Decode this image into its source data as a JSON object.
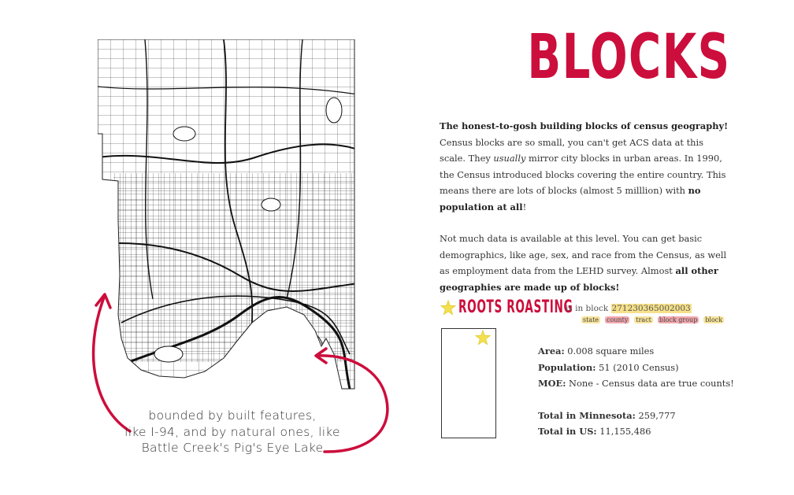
{
  "title": "BLOCKS",
  "intro": {
    "heading": "The honest-to-gosh building blocks of census geography!",
    "text1": " Census blocks are so small, you can't get ACS data at this scale. They ",
    "usually": "usually",
    "text2": " mirror city blocks in urban areas. In 1990, the Census introduced blocks covering the entire country. This means there are lots of blocks (almost 5 milllion) with ",
    "bold_end": "no population at all",
    "end": "!"
  },
  "para2": {
    "text": "Not much data is available at this level. You can get basic demographics, like age, sex, and race from the Census, as well as employment data from the LEHD survey. Almost ",
    "bold": "all other geographies are made up of blocks!"
  },
  "store": {
    "name": "ROOTS ROASTING",
    "phrase": "is in block ",
    "block_id": "271230365002003",
    "labels": {
      "state": "state",
      "county": "county",
      "tract": "tract",
      "block_group": "block group",
      "block": "block"
    }
  },
  "stats": {
    "area_label": "Area:",
    "area_value": " 0.008 square miles",
    "population_label": "Population:",
    "population_value": " 51 (2010 Census)",
    "moe_label": "MOE:",
    "moe_value": " None - Census data are true counts!",
    "total_mn_label": "Total in Minnesota:",
    "total_mn_value": " 259,777",
    "total_us_label": "Total in US:",
    "total_us_value": " 11,155,486"
  },
  "caption": {
    "line1": "bounded by built features,",
    "line2": "like I-94, and by natural ones, like",
    "line3": "Battle Creek's Pig's Eye Lake"
  },
  "colors": {
    "accent": "#cc0e3c",
    "star": "#f3e04f",
    "highlight_yellow": "#f6e08a",
    "highlight_pink": "#f1a8ae"
  }
}
